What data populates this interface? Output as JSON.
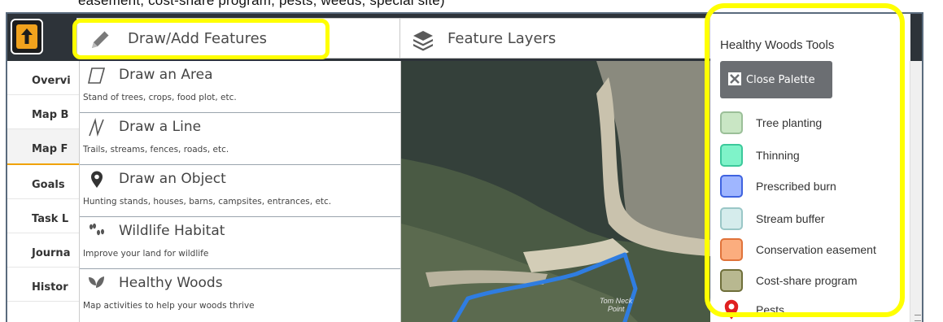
{
  "caption_cutoff": "easement, cost-share program, pests, weeds, special site)",
  "toolbar": {
    "draw_tab_label": "Draw/Add Features",
    "layers_tab_label": "Feature Layers"
  },
  "leftnav": {
    "items": [
      {
        "label": "Overvi"
      },
      {
        "label": "Map B"
      },
      {
        "label": "Map F"
      },
      {
        "label": "Goals"
      },
      {
        "label": "Task L"
      },
      {
        "label": "Journa"
      },
      {
        "label": "Histor"
      }
    ]
  },
  "draw_menu": {
    "items": [
      {
        "title": "Draw an Area",
        "subtitle": "Stand of trees, crops, food plot, etc.",
        "icon": "area-icon"
      },
      {
        "title": "Draw a Line",
        "subtitle": "Trails, streams, fences, roads, etc.",
        "icon": "line-icon"
      },
      {
        "title": "Draw an Object",
        "subtitle": "Hunting stands, houses, barns, campsites, entrances, etc.",
        "icon": "map-pin-icon"
      },
      {
        "title": "Wildlife Habitat",
        "subtitle": "Improve your land for wildlife",
        "icon": "paw-prints-icon"
      },
      {
        "title": "Healthy Woods",
        "subtitle": "Map activities to help your woods thrive",
        "icon": "leaf-icon"
      }
    ]
  },
  "map": {
    "place_label_line1": "Tom Neck",
    "place_label_line2": "Point"
  },
  "palette": {
    "title": "Healthy Woods Tools",
    "close_label": "Close Palette",
    "items": [
      {
        "label": "Tree planting",
        "fill": "#c9e6c4",
        "border": "#9bbf98"
      },
      {
        "label": "Thinning",
        "fill": "#7ff3c9",
        "border": "#3cc99b"
      },
      {
        "label": "Prescribed burn",
        "fill": "#9fb6ff",
        "border": "#3f63e0"
      },
      {
        "label": "Stream buffer",
        "fill": "#d5ecec",
        "border": "#9ac7c7"
      },
      {
        "label": "Conservation easement",
        "fill": "#fbad7e",
        "border": "#e0733a"
      },
      {
        "label": "Cost-share program",
        "fill": "#b8b890",
        "border": "#6f6f3a"
      },
      {
        "label": "Pests",
        "fill": "#e02020",
        "border": "#b01515"
      }
    ]
  },
  "colors": {
    "highlight": "#ffff00",
    "topbar": "#2d3339",
    "upload_accent": "#f1a21d",
    "route_line": "#2f7de1"
  }
}
